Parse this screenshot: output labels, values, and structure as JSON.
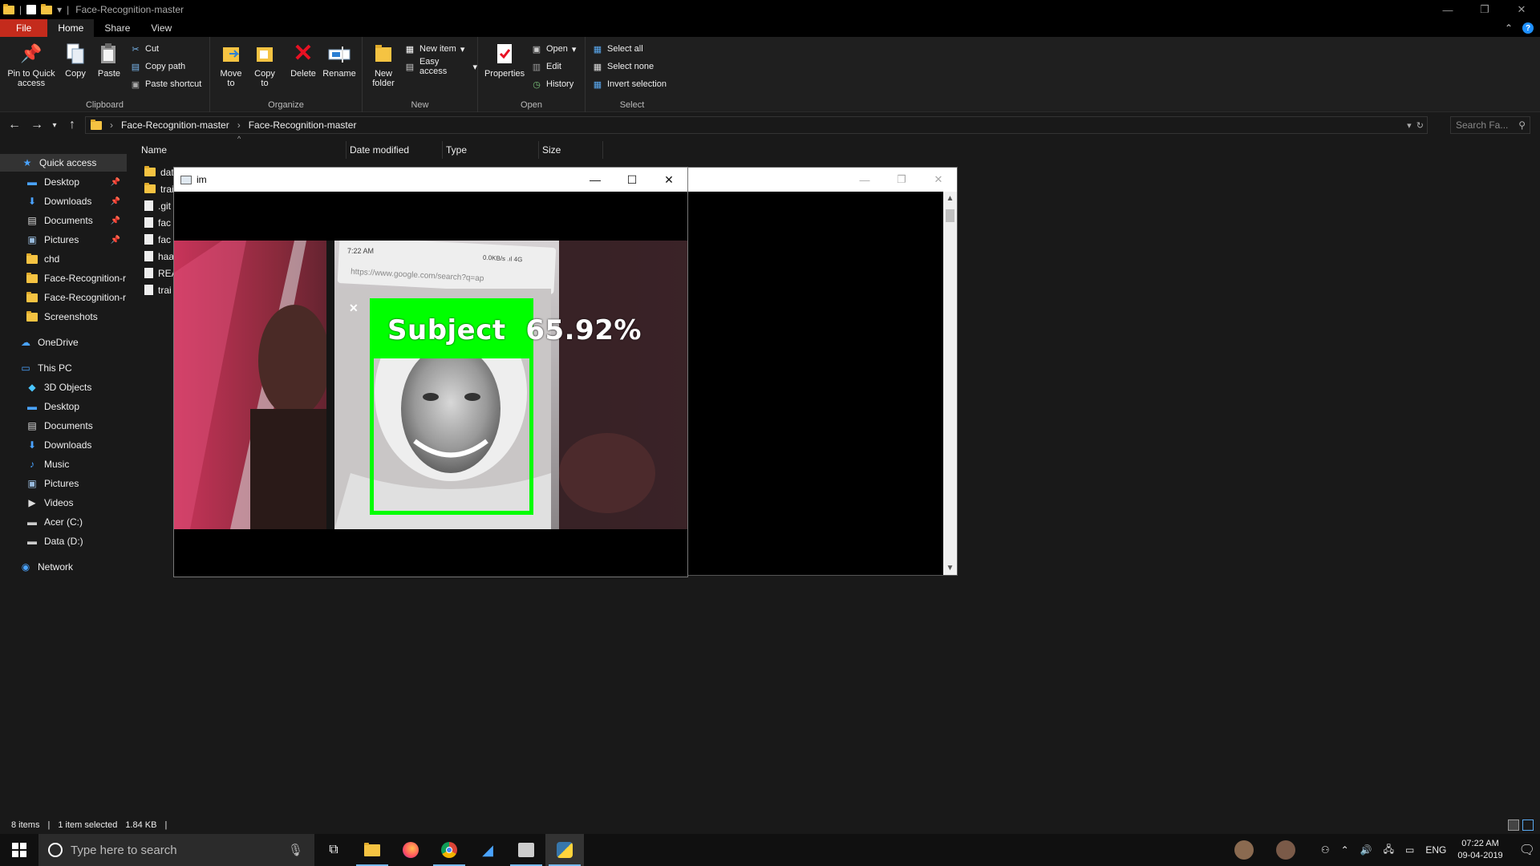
{
  "window": {
    "title": "Face-Recognition-master",
    "controls": [
      "—",
      "❐",
      "✕"
    ]
  },
  "ribbon_tabs": [
    "File",
    "Home",
    "Share",
    "View"
  ],
  "ribbon": {
    "clipboard": {
      "name": "Clipboard",
      "pin": "Pin to Quick access",
      "copy": "Copy",
      "paste": "Paste",
      "cut": "Cut",
      "copy_path": "Copy path",
      "paste_shortcut": "Paste shortcut"
    },
    "organize": {
      "name": "Organize",
      "move_to": "Move to",
      "copy_to": "Copy to",
      "delete": "Delete",
      "rename": "Rename"
    },
    "new": {
      "name": "New",
      "new_folder": "New folder",
      "new_item": "New item",
      "easy_access": "Easy access"
    },
    "open": {
      "name": "Open",
      "properties": "Properties",
      "open": "Open",
      "edit": "Edit",
      "history": "History"
    },
    "select": {
      "name": "Select",
      "select_all": "Select all",
      "select_none": "Select none",
      "invert": "Invert selection"
    }
  },
  "address": {
    "crumbs": [
      "Face-Recognition-master",
      "Face-Recognition-master"
    ],
    "search_placeholder": "Search Fa..."
  },
  "nav": {
    "quick_access": "Quick access",
    "quick_items": [
      {
        "label": "Desktop",
        "pinned": true
      },
      {
        "label": "Downloads",
        "pinned": true
      },
      {
        "label": "Documents",
        "pinned": true
      },
      {
        "label": "Pictures",
        "pinned": true
      },
      {
        "label": "chd",
        "pinned": false
      },
      {
        "label": "Face-Recognition-r",
        "pinned": false
      },
      {
        "label": "Face-Recognition-r",
        "pinned": false
      },
      {
        "label": "Screenshots",
        "pinned": false
      }
    ],
    "onedrive": "OneDrive",
    "this_pc": "This PC",
    "pc_items": [
      "3D Objects",
      "Desktop",
      "Documents",
      "Downloads",
      "Music",
      "Pictures",
      "Videos",
      "Acer (C:)",
      "Data (D:)"
    ],
    "network": "Network"
  },
  "columns": [
    "Name",
    "Date modified",
    "Type",
    "Size"
  ],
  "files": [
    "dat",
    "trai",
    ".git",
    "fac",
    "fac",
    "haa",
    "REA",
    "trai"
  ],
  "status": {
    "items": "8 items",
    "selected": "1 item selected",
    "size": "1.84 KB"
  },
  "im_window": {
    "title": "im",
    "label": "Subject  65.92%",
    "phone_time": "7:22 AM",
    "phone_net": "0.0KB/s  .ıl 4G",
    "phone_url": "https://www.google.com/search?q=ap",
    "close_mark": "✕"
  },
  "taskbar": {
    "search_placeholder": "Type here to search",
    "lang": "ENG",
    "time": "07:22 AM",
    "date": "09-04-2019"
  },
  "colors": {
    "accent_file": "#c42b1c",
    "detection_green": "#00ff00"
  }
}
